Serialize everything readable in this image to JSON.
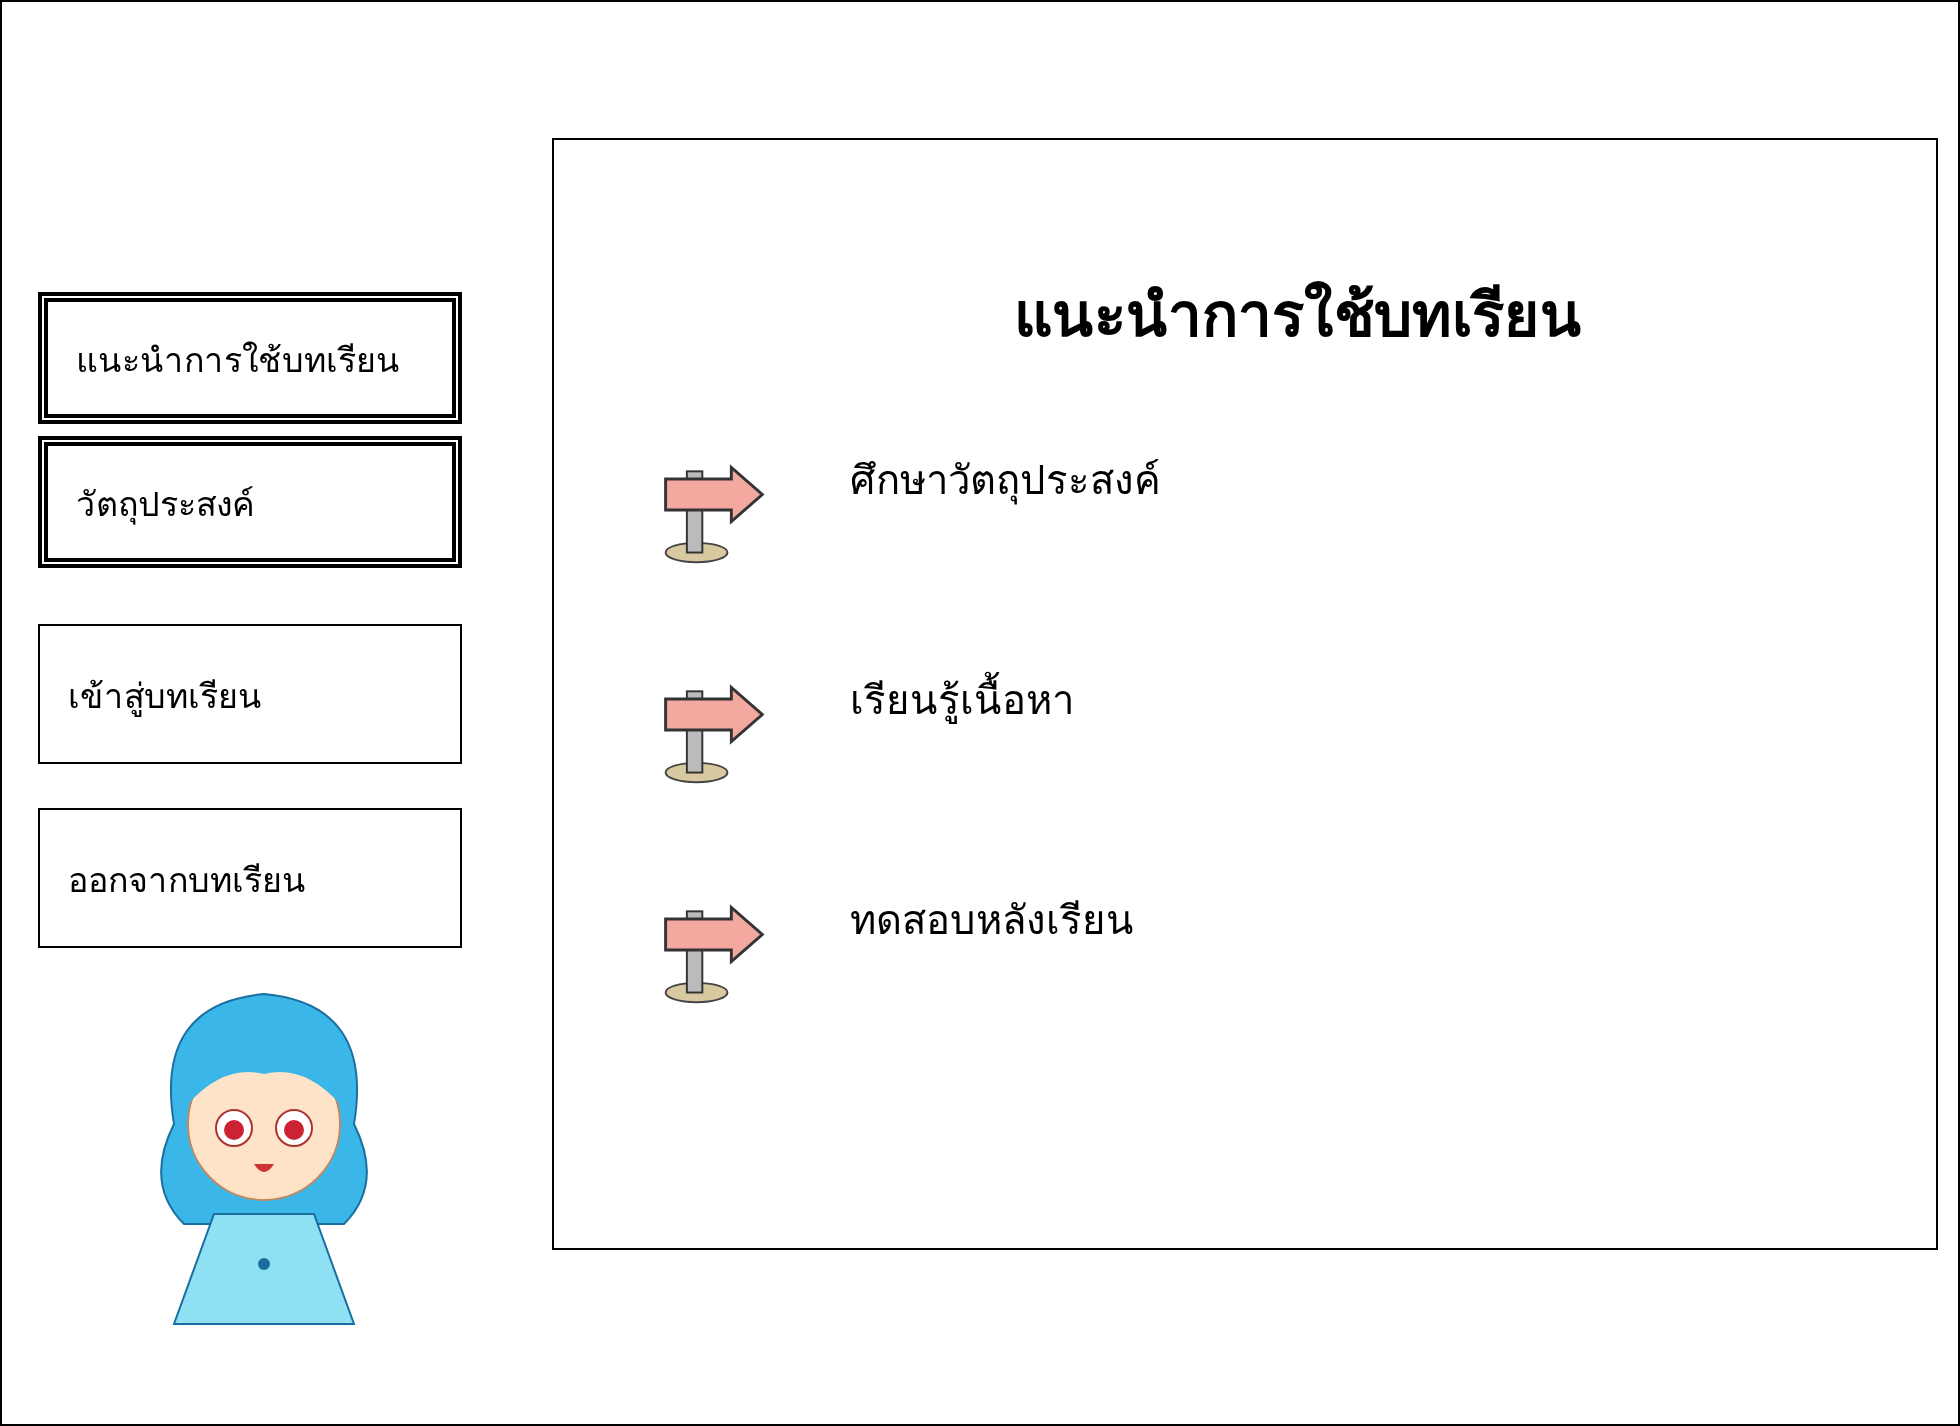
{
  "menu": [
    {
      "label": "แนะนำการใช้บทเรียน",
      "kind": "double"
    },
    {
      "label": "วัตถุประสงค์",
      "kind": "double"
    },
    {
      "label": "เข้าสู่บทเรียน",
      "kind": "single"
    },
    {
      "label": "ออกจากบทเรียน",
      "kind": "single"
    }
  ],
  "panel": {
    "title": "แนะนำการใช้บทเรียน",
    "items": [
      "ศึกษาวัตถุประสงค์",
      "เรียนรู้เนื้อหา",
      "ทดสอบหลังเรียน"
    ]
  }
}
